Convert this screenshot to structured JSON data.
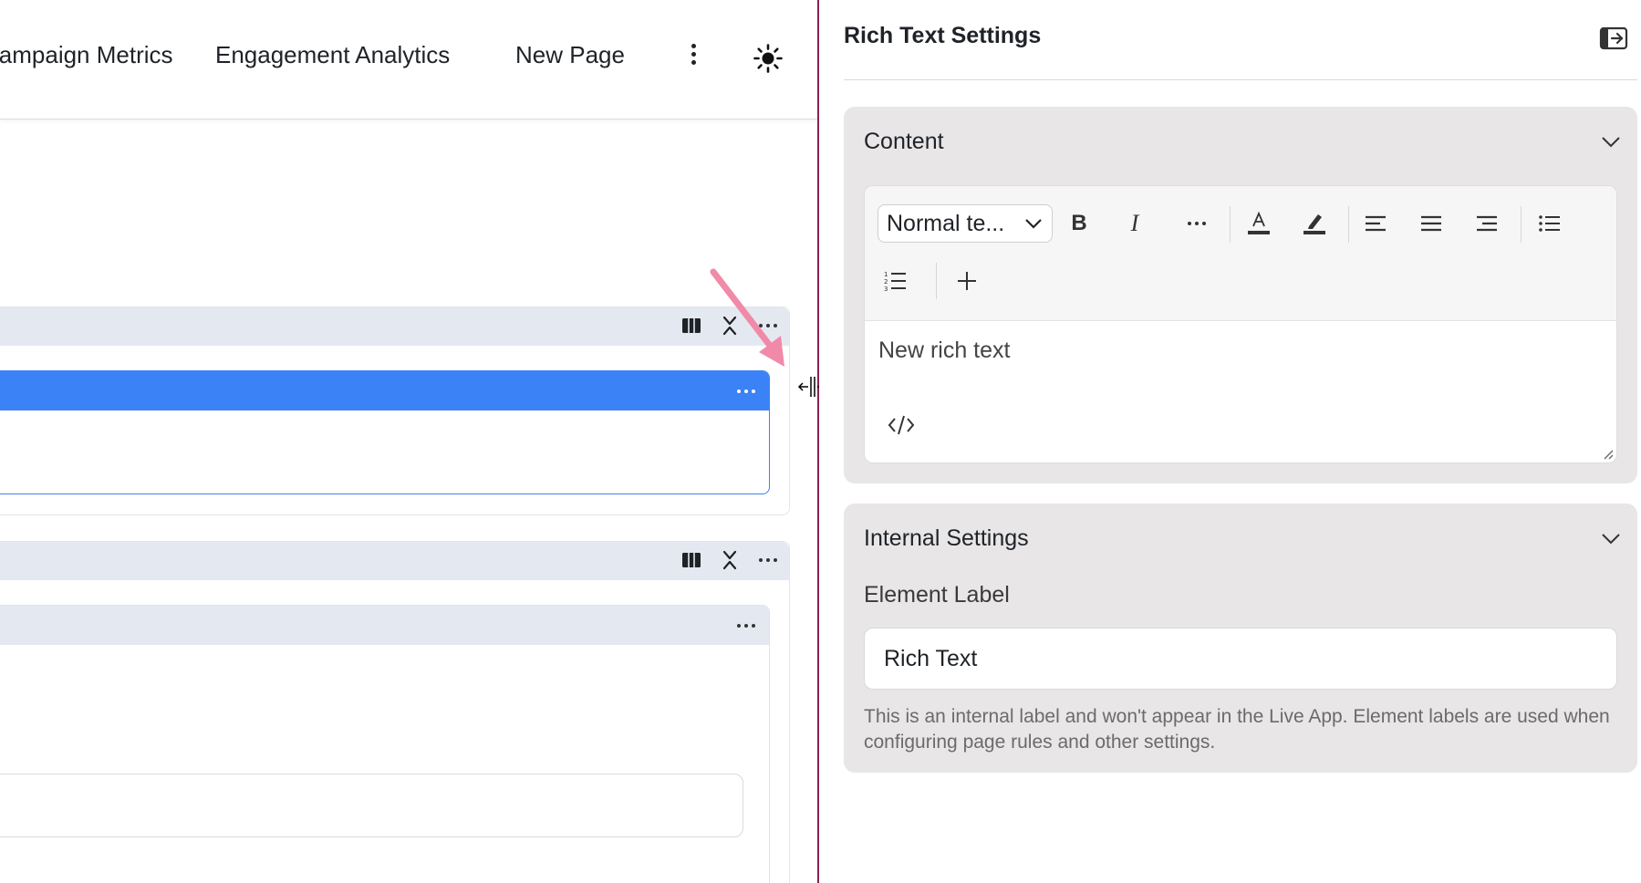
{
  "nav": {
    "items": [
      "Campaign Metrics",
      "Engagement Analytics",
      "New Page"
    ]
  },
  "panel": {
    "title": "Rich Text Settings",
    "content": {
      "title": "Content",
      "text_style": "Normal te...",
      "bold_label": "B",
      "italic_label": "I",
      "editor_text": "New rich text"
    },
    "internal": {
      "title": "Internal Settings",
      "field_label": "Element Label",
      "field_value": "Rich Text",
      "help_text": "This is an internal label and won't appear in the Live App. Element labels are used when configuring page rules and other settings."
    }
  },
  "colors": {
    "accent_blue": "#3b82f6",
    "divider": "#8a2056",
    "arrow": "#f08aa8",
    "card_bg": "#e8e6e7"
  }
}
